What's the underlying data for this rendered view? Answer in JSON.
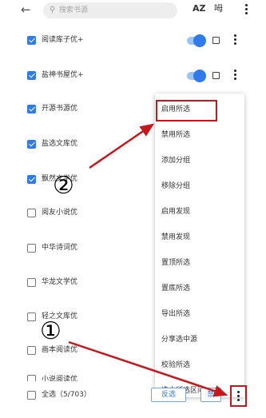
{
  "topbar": {
    "back_icon": "arrow-left-icon",
    "search_placeholder": "搜索书源",
    "sort_label": "AZ",
    "group_label": "呣"
  },
  "rows": [
    {
      "label": "阅读库子优+",
      "checked": true,
      "toggle": true
    },
    {
      "label": "盐神书屋优+",
      "checked": true,
      "toggle": true
    },
    {
      "label": "开源书源优",
      "checked": true,
      "toggle": false
    },
    {
      "label": "盐选文库优",
      "checked": true,
      "toggle": false
    },
    {
      "label": "飘然文学优",
      "checked": true,
      "toggle": false
    },
    {
      "label": "阅友小说优",
      "checked": false,
      "toggle": false
    },
    {
      "label": "中华诗词优",
      "checked": false,
      "toggle": false
    },
    {
      "label": "华龙文学优",
      "checked": false,
      "toggle": false
    },
    {
      "label": "轻之文库优",
      "checked": false,
      "toggle": false
    },
    {
      "label": "画本阅读优",
      "checked": false,
      "toggle": false
    },
    {
      "label": "小说阅读优",
      "checked": false,
      "toggle": false
    }
  ],
  "menu": {
    "items": [
      "启用所选",
      "禁用所选",
      "添加分组",
      "移除分组",
      "启用发现",
      "禁用发现",
      "置顶所选",
      "置底所选",
      "导出所选",
      "分享选中源",
      "校验所选",
      "选中所选区间"
    ]
  },
  "bottom": {
    "select_all_label": "全选（5/703）",
    "invert_label": "反选",
    "second_button_label": "禁"
  },
  "annotations": {
    "step_one": "①",
    "step_two": "②",
    "highlight_color": "#c8171c"
  },
  "colors": {
    "accent": "#2f7bea"
  }
}
